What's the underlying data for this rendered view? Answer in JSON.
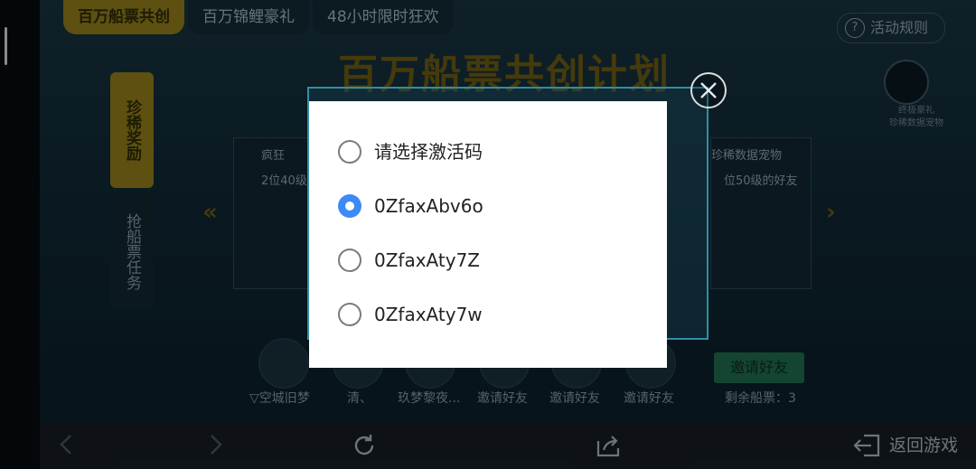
{
  "game": {
    "tabs": [
      "百万船票共创",
      "百万锦鲤豪礼",
      "48小时限时狂欢"
    ],
    "activity_rules": "活动规则",
    "banner_title": "百万船票共创计划",
    "side_tabs": [
      "珍稀奖励",
      "抢船票任务"
    ],
    "card_left": {
      "title": "疯狂",
      "subtitle": "2位40级"
    },
    "card_right": {
      "title": "珍稀数据宠物",
      "subtitle": "位50级的好友"
    },
    "right_icon_text": [
      "终极豪礼",
      "珍稀数据宠物"
    ],
    "friends": [
      "▽空城旧梦",
      "清、",
      "玖梦黎夜...",
      "邀请好友",
      "邀请好友",
      "邀请好友"
    ],
    "invite_button": "邀请好友",
    "remaining_tickets": "剩余船票：3"
  },
  "bottom_nav": {
    "return_game": "返回游戏"
  },
  "dialog": {
    "options": [
      {
        "label": "请选择激活码",
        "selected": false
      },
      {
        "label": "0ZfaxAbv6o",
        "selected": true
      },
      {
        "label": "0ZfaxAty7Z",
        "selected": false
      },
      {
        "label": "0ZfaxAty7w",
        "selected": false
      }
    ]
  },
  "colors": {
    "radio_selected": "#3d8af7",
    "frame_accent": "#2f8fa6"
  }
}
